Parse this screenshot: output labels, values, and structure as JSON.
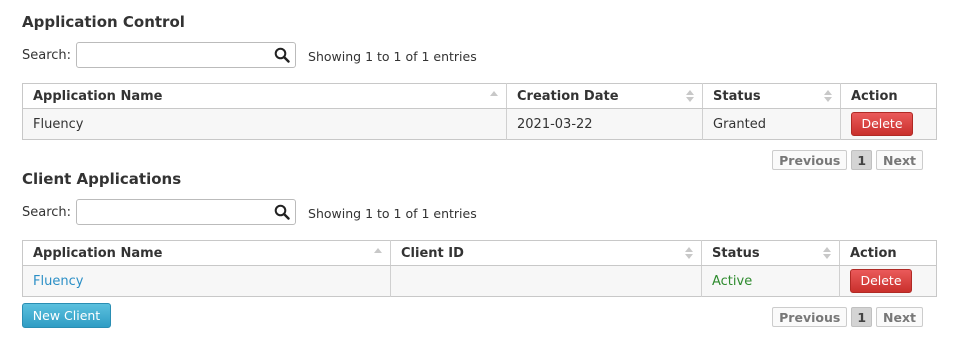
{
  "app_control": {
    "title": "Application Control",
    "search_label": "Search:",
    "search_value": "",
    "info": "Showing 1 to 1 of 1 entries",
    "columns": [
      "Application Name",
      "Creation Date",
      "Status",
      "Action"
    ],
    "rows": [
      {
        "name": "Fluency",
        "date": "2021-03-22",
        "status": "Granted",
        "action": "Delete"
      }
    ],
    "pagination": {
      "previous": "Previous",
      "current": "1",
      "next": "Next"
    }
  },
  "client_apps": {
    "title": "Client Applications",
    "search_label": "Search:",
    "search_value": "",
    "info": "Showing 1 to 1 of 1 entries",
    "columns": [
      "Application Name",
      "Client ID",
      "Status",
      "Action"
    ],
    "rows": [
      {
        "name": "Fluency",
        "client_id": "",
        "status": "Active",
        "action": "Delete"
      }
    ],
    "new_client_label": "New Client",
    "pagination": {
      "previous": "Previous",
      "current": "1",
      "next": "Next"
    }
  },
  "icons": {
    "search": "search-icon",
    "sort": "sort-icon"
  },
  "colors": {
    "delete": "#d9534f",
    "link": "#2b8fc6",
    "active": "#2e8b2e",
    "new_client": "#5bc0de"
  }
}
